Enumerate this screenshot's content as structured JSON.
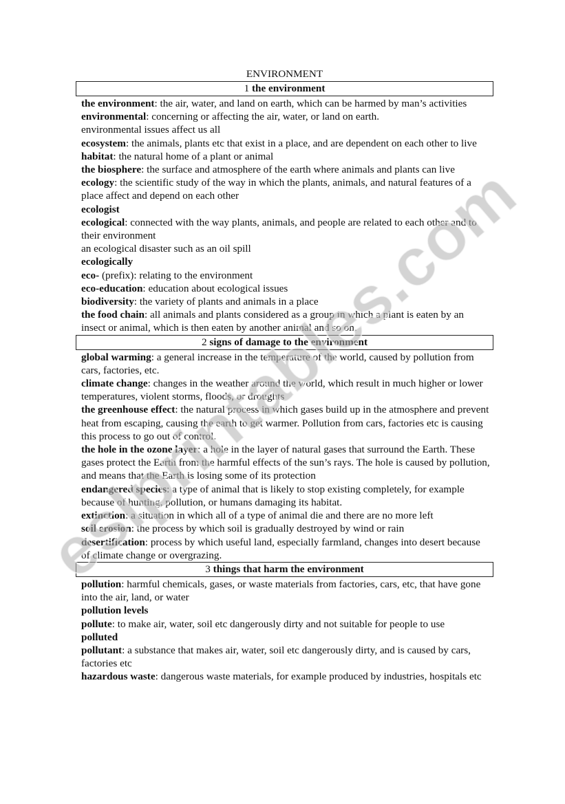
{
  "title": "ENVIRONMENT",
  "sections": [
    {
      "number": "1",
      "name": "the environment",
      "entries": [
        {
          "term": "the environment",
          "def": "the air, water, and land on earth, which can be harmed by man’s activities"
        },
        {
          "term": "environmental",
          "def": "concerning or affecting the air, water, or land on earth."
        },
        {
          "term": "",
          "def": "environmental issues affect us all"
        },
        {
          "term": "ecosystem",
          "def": "the animals, plants etc that exist in a place, and are dependent on each other to live"
        },
        {
          "term": "habitat",
          "def": "the natural home of a plant or animal"
        },
        {
          "term": "the biosphere",
          "def": "the surface and atmosphere of the earth where animals and plants can live"
        },
        {
          "term": "ecology",
          "def": "the scientific study of the way in which the plants, animals, and natural features of a place affect and depend on each other"
        },
        {
          "term": "ecologist",
          "def": ""
        },
        {
          "term": "ecological",
          "def": "connected with the way plants, animals, and people are related to each other and to their environment"
        },
        {
          "term": "",
          "def": "an ecological disaster such as an oil spill"
        },
        {
          "term": "ecologically",
          "def": ""
        },
        {
          "term": "eco-",
          "def": "(prefix): relating to the environment",
          "nocolon": true
        },
        {
          "term": "eco-education",
          "def": "education about ecological issues"
        },
        {
          "term": "biodiversity",
          "def": "the variety of plants and animals in a place"
        },
        {
          "term": "the food chain",
          "def": "all animals and plants considered as a group in which a plant is eaten by an insect or animal, which is then eaten by another animal and so on."
        }
      ]
    },
    {
      "number": "2",
      "name": "signs of damage to the environment",
      "entries": [
        {
          "term": "global warming",
          "def": "a general increase in the temperature of the world, caused by pollution from cars, factories, etc."
        },
        {
          "term": "climate change",
          "def": "changes in the weather around the world, which result in much higher or lower temperatures, violent storms, floods, or droughts"
        },
        {
          "term": "the greenhouse effect",
          "def": "the natural process in which gases build up in the atmosphere and prevent heat from escaping, causing the earth to get warmer. Pollution from cars, factories etc is causing this process to go out of control."
        },
        {
          "term": "the hole in the ozone layer",
          "def": "a hole in the layer of natural gases that surround the Earth. These gases protect the Earth from the harmful effects of the sun’s rays. The hole is caused by pollution, and means that the Earth is losing some of its protection"
        },
        {
          "term": "endangered species",
          "def": "a type of animal that is likely to stop existing completely, for example because of hunting, pollution, or humans damaging its habitat."
        },
        {
          "term": "extinction",
          "def": "a situation in which all of a type of animal die and there are no more left"
        },
        {
          "term": "soil erosion",
          "def": "the process by which soil is gradually destroyed by wind or rain"
        },
        {
          "term": "desertification",
          "def": "process by which useful land, especially farmland, changes into desert because of climate change or overgrazing."
        }
      ]
    },
    {
      "number": "3",
      "name": "things that harm the environment",
      "entries": [
        {
          "term": "pollution",
          "def": "harmful chemicals, gases, or waste materials from factories, cars, etc, that have gone into the air, land, or water"
        },
        {
          "term": "pollution levels",
          "def": ""
        },
        {
          "term": "pollute",
          "def": "to make air, water, soil etc dangerously dirty and not suitable for people to use"
        },
        {
          "term": "polluted",
          "def": ""
        },
        {
          "term": "pollutant",
          "def": "a substance that makes air, water, soil etc dangerously dirty, and is caused by cars, factories etc"
        },
        {
          "term": "hazardous waste",
          "def": "dangerous waste materials, for example produced by industries, hospitals etc"
        }
      ]
    }
  ],
  "watermark": "eslprintables.com",
  "colors": {
    "text": "#111111",
    "watermark": "#b0b0b0",
    "border": "#222222"
  }
}
